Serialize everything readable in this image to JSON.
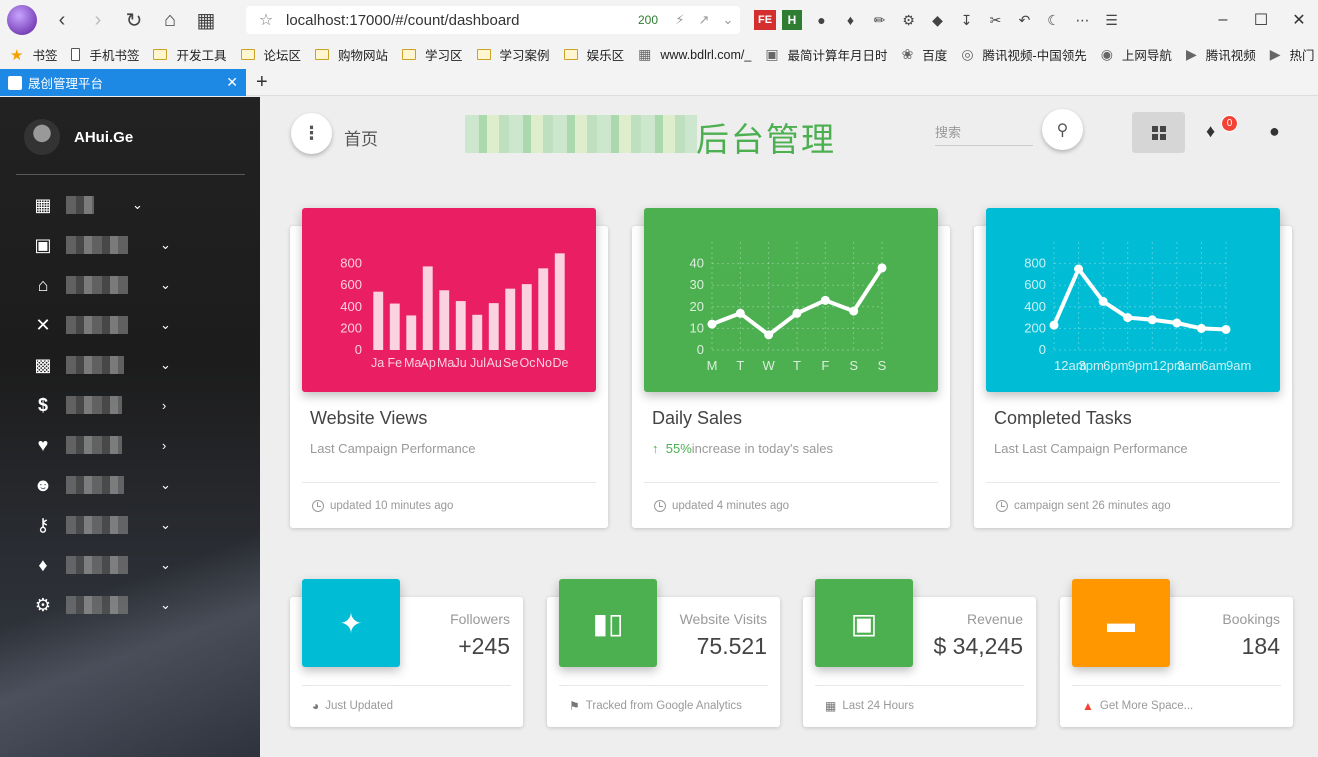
{
  "browser": {
    "url": "localhost:17000/#/count/dashboard",
    "status_code": "200",
    "bookmarks": [
      "书签",
      "手机书签",
      "开发工具",
      "论坛区",
      "购物网站",
      "学习区",
      "学习案例",
      "娱乐区",
      "www.bdlrl.com/_",
      "最简计算年月日时",
      "百度",
      "腾讯视频-中国领先",
      "上网导航",
      "腾讯视频",
      "热门"
    ],
    "tab_title": "晟创管理平台",
    "toolbar_fe": "FE",
    "toolbar_h": "H"
  },
  "sidebar": {
    "user_name": "AHui.Ge",
    "menu_icons": [
      "apps-icon",
      "business-icon",
      "home-icon",
      "build-icon",
      "store-icon",
      "dollar-icon",
      "handshake-icon",
      "people-icon",
      "key-icon",
      "notifications-icon",
      "settings-icon"
    ]
  },
  "header": {
    "breadcrumb": "首页",
    "title": "后台管理",
    "search_placeholder": "搜索",
    "notification_count": "0"
  },
  "charts": [
    {
      "title": "Website Views",
      "subtitle": "Last Campaign Performance",
      "footer": "updated 10 minutes ago",
      "color": "#e91e63",
      "chart_data": {
        "type": "bar",
        "categories": [
          "Ja",
          "Fe",
          "Ma",
          "Ap",
          "Ma",
          "Ju",
          "Jul",
          "Au",
          "Se",
          "Oc",
          "No",
          "De"
        ],
        "values": [
          540,
          430,
          320,
          774,
          553,
          453,
          326,
          434,
          568,
          610,
          756,
          895
        ],
        "yticks": [
          "800",
          "600",
          "400",
          "200",
          "0"
        ],
        "ylim": [
          0,
          1000
        ]
      }
    },
    {
      "title": "Daily Sales",
      "subtitle_highlight": "55%",
      "subtitle": "increase in today's sales",
      "footer": "updated 4 minutes ago",
      "color": "#4caf50",
      "chart_data": {
        "type": "line",
        "categories": [
          "M",
          "T",
          "W",
          "T",
          "F",
          "S",
          "S"
        ],
        "values": [
          12,
          17,
          7,
          17,
          23,
          18,
          38
        ],
        "yticks": [
          "40",
          "30",
          "20",
          "10",
          "0"
        ],
        "ylim": [
          0,
          50
        ]
      }
    },
    {
      "title": "Completed Tasks",
      "subtitle": "Last Last Campaign Performance",
      "footer": "campaign sent 26 minutes ago",
      "color": "#00bcd4",
      "chart_data": {
        "type": "line",
        "categories": [
          "12am",
          "3pm",
          "6pm",
          "9pm",
          "12pm",
          "3am",
          "6am",
          "9am"
        ],
        "values": [
          230,
          750,
          450,
          300,
          280,
          250,
          200,
          190
        ],
        "yticks": [
          "800",
          "600",
          "400",
          "200",
          "0"
        ],
        "ylim": [
          0,
          1000
        ]
      }
    }
  ],
  "stats": [
    {
      "label": "Followers",
      "value": "+245",
      "footer": "Just Updated",
      "color": "#00bcd4",
      "icon": "twitter-icon",
      "footer_icon": "update-icon"
    },
    {
      "label": "Website Visits",
      "value": "75.521",
      "footer": "Tracked from Google Analytics",
      "color": "#4caf50",
      "icon": "bar-chart-icon",
      "footer_icon": "tag-icon"
    },
    {
      "label": "Revenue",
      "value": "$ 34,245",
      "footer": "Last 24 Hours",
      "color": "#4caf50",
      "icon": "store-icon",
      "footer_icon": "calendar-icon"
    },
    {
      "label": "Bookings",
      "value": "184",
      "footer": "Get More Space...",
      "color": "#ff9800",
      "icon": "weekend-icon",
      "footer_icon": "warning-icon"
    }
  ]
}
